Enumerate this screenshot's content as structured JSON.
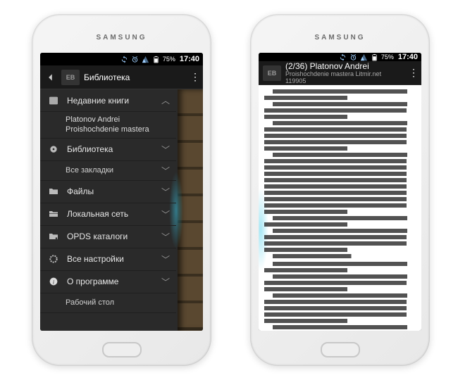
{
  "device_brand": "SAMSUNG",
  "status": {
    "battery_pct": "75%",
    "time": "17:40"
  },
  "left": {
    "header_title": "Библиотека",
    "sections": {
      "recent": "Недавние книги",
      "library": "Библиотека",
      "bookmarks": "Все закладки",
      "files": "Файлы",
      "lan": "Локальная сеть",
      "opds": "OPDS каталоги",
      "settings": "Все настройки",
      "about": "О программе",
      "desktop": "Рабочий стол"
    },
    "recent_book": {
      "author": "Platonov Andrei",
      "title": "Proishochdenie mastera"
    }
  },
  "right": {
    "header_line1": "(2/36) Platonov Andrei",
    "header_line2": "Proishochdenie mastera  Litmir.net",
    "header_line3": "119905"
  }
}
